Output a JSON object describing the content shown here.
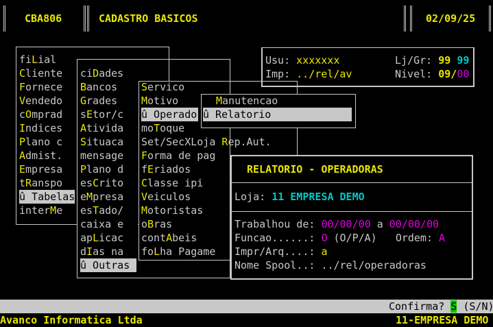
{
  "header": {
    "program_code": "CBA806",
    "program_title": "CADASTRO BASICOS",
    "date": "02/09/25"
  },
  "session": {
    "usu_label": "Usu:",
    "usu_value": "xxxxxxx",
    "imp_label": "Imp:",
    "imp_value": "../rel/av",
    "ljgr_label": "Lj/Gr:",
    "ljgr_value1": "99",
    "ljgr_value2": "99",
    "nivel_label": "Nivel:",
    "nivel_value1": "09",
    "nivel_sep": "/",
    "nivel_value2": "00"
  },
  "menu1": {
    "items": [
      {
        "pre": "fi",
        "hot": "L",
        "post": "ial"
      },
      {
        "pre": "",
        "hot": "C",
        "post": "liente"
      },
      {
        "pre": "",
        "hot": "F",
        "post": "ornece"
      },
      {
        "pre": "",
        "hot": "V",
        "post": "endedo"
      },
      {
        "pre": "c",
        "hot": "O",
        "post": "mprad"
      },
      {
        "pre": "",
        "hot": "I",
        "post": "ndices"
      },
      {
        "pre": "",
        "hot": "P",
        "post": "lano c"
      },
      {
        "pre": "",
        "hot": "A",
        "post": "dmist."
      },
      {
        "pre": "",
        "hot": "E",
        "post": "mpresa"
      },
      {
        "pre": "t",
        "hot": "R",
        "post": "anspo"
      },
      {
        "pre": "û Tabelas",
        "hot": "",
        "post": ""
      },
      {
        "pre": "inter",
        "hot": "M",
        "post": "e"
      }
    ]
  },
  "menu2": {
    "items": [
      {
        "pre": "ci",
        "hot": "D",
        "post": "ades"
      },
      {
        "pre": "",
        "hot": "B",
        "post": "ancos"
      },
      {
        "pre": "",
        "hot": "G",
        "post": "rades"
      },
      {
        "pre": "s",
        "hot": "E",
        "post": "tor/c"
      },
      {
        "pre": "",
        "hot": "A",
        "post": "tivida"
      },
      {
        "pre": "",
        "hot": "S",
        "post": "ituaca"
      },
      {
        "pre": "mensage",
        "hot": "",
        "post": ""
      },
      {
        "pre": "",
        "hot": "P",
        "post": "lano d"
      },
      {
        "pre": "es",
        "hot": "C",
        "post": "rito"
      },
      {
        "pre": "e",
        "hot": "M",
        "post": "presa"
      },
      {
        "pre": "es",
        "hot": "T",
        "post": "ado/"
      },
      {
        "pre": "caixa e",
        "hot": "",
        "post": ""
      },
      {
        "pre": "ap",
        "hot": "L",
        "post": "icac"
      },
      {
        "pre": "d",
        "hot": "I",
        "post": "as na"
      },
      {
        "pre": "û Outras",
        "hot": "",
        "post": ""
      }
    ]
  },
  "menu3": {
    "items": [
      {
        "pre": "",
        "hot": "S",
        "post": "ervico"
      },
      {
        "pre": "",
        "hot": "M",
        "post": "otivo"
      },
      {
        "pre": "û Operado",
        "hot": "",
        "post": ""
      },
      {
        "pre": "mo",
        "hot": "T",
        "post": "oque"
      },
      {
        "pre": "Set/SecXLoja ",
        "hot": "R",
        "post": "ep.Aut."
      },
      {
        "pre": "",
        "hot": "F",
        "post": "orma de pag"
      },
      {
        "pre": "f",
        "hot": "E",
        "post": "riados"
      },
      {
        "pre": "",
        "hot": "C",
        "post": "lasse ipi"
      },
      {
        "pre": "",
        "hot": "V",
        "post": "eiculos"
      },
      {
        "pre": "",
        "hot": "M",
        "post": "otoristas"
      },
      {
        "pre": "o",
        "hot": "B",
        "post": "ras"
      },
      {
        "pre": "cont",
        "hot": "A",
        "post": "beis"
      },
      {
        "pre": "fo",
        "hot": "L",
        "post": "ha Pagame"
      }
    ]
  },
  "menu4": {
    "items": [
      {
        "pre": "",
        "hot": "M",
        "post": "anutencao"
      },
      {
        "pre": "û Relatorio",
        "hot": "",
        "post": ""
      }
    ]
  },
  "dialog": {
    "title": "RELATORIO - OPERADORAS",
    "loja_label": "Loja:",
    "loja_value": "11 EMPRESA DEMO",
    "trab_label": "Trabalhou de:",
    "trab_from": "00/00/00",
    "trab_mid": "a",
    "trab_to": "00/00/00",
    "funcao_label": "Funcao......:",
    "funcao_value": "O",
    "funcao_opts": "(O/P/A)",
    "ordem_label": "Ordem:",
    "ordem_value": "A",
    "impr_label": "Impr/Arq....:",
    "impr_value": "a",
    "spool_label": "Nome Spool..:",
    "spool_value": "../rel/operadoras"
  },
  "status": {
    "confirm_label": "Confirma?",
    "confirm_value": "S",
    "confirm_opts": "(S/N)"
  },
  "footer": {
    "company": "Avanco Informatica Ltda",
    "branch": "11-EMPRESA DEMO"
  },
  "colors": {
    "background": "#000000",
    "text": "#c8c8c8",
    "hotkey": "#e8e800",
    "value_cyan": "#00c8c8",
    "value_magenta": "#e000e0",
    "highlight_bg": "#c8c8c8",
    "confirm_green": "#00c800"
  }
}
